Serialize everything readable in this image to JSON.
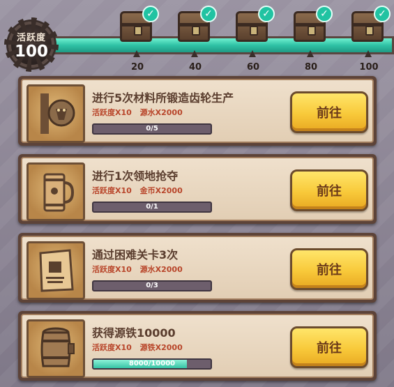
{
  "activity": {
    "label": "活跃度",
    "value": "100",
    "progress": 1.0
  },
  "milestones": [
    {
      "label": "20",
      "claimed": true
    },
    {
      "label": "40",
      "claimed": true
    },
    {
      "label": "60",
      "claimed": true
    },
    {
      "label": "80",
      "claimed": true
    },
    {
      "label": "100",
      "claimed": true
    }
  ],
  "tasks": [
    {
      "title": "进行5次材料所锻造齿轮生产",
      "reward1": "活跃度X10",
      "reward2": "源水X2000",
      "progress_text": "0/5",
      "progress": 0,
      "button": "前往",
      "icon": "gear-lion-icon"
    },
    {
      "title": "进行1次领地抢夺",
      "reward1": "活跃度X10",
      "reward2": "金币X2000",
      "progress_text": "0/1",
      "progress": 0,
      "button": "前往",
      "icon": "mug-icon"
    },
    {
      "title": "通过困难关卡3次",
      "reward1": "活跃度X10",
      "reward2": "源水X2000",
      "progress_text": "0/3",
      "progress": 0,
      "button": "前往",
      "icon": "wanted-poster-icon"
    },
    {
      "title": "获得源铁10000",
      "reward1": "活跃度X10",
      "reward2": "源铁X2000",
      "progress_text": "8000/10000",
      "progress": 0.8,
      "button": "前往",
      "icon": "barrel-icon"
    }
  ],
  "colors": {
    "accent_teal": "#2fc2a5",
    "button_yellow": "#f8c93a",
    "reward_red": "#b8452a"
  }
}
